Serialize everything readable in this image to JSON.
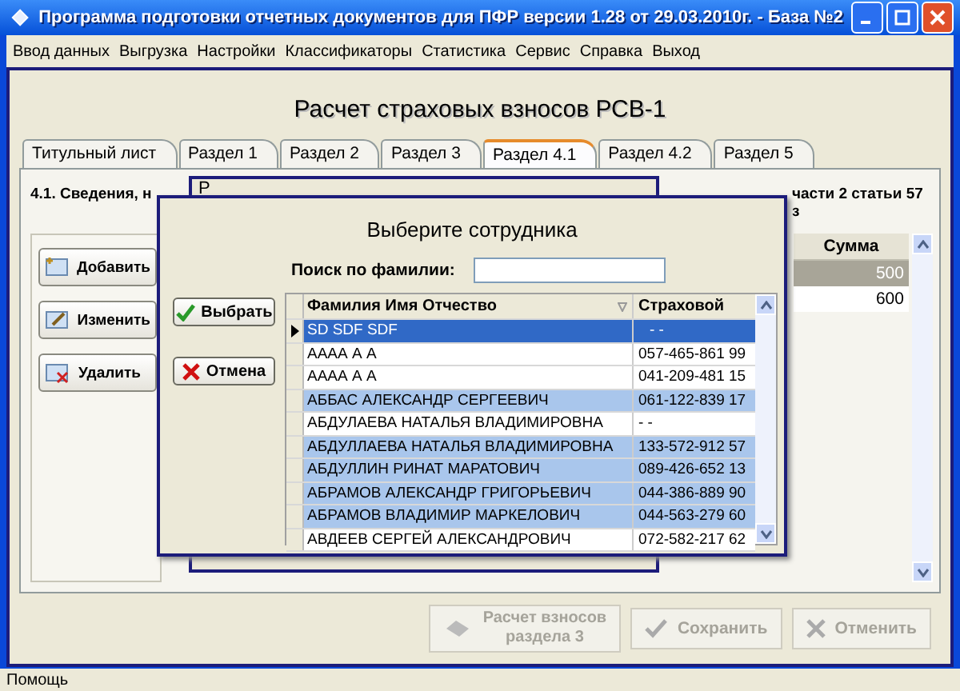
{
  "window": {
    "title": "Программа подготовки отчетных документов для ПФР версии 1.28 от 29.03.2010г. - База №2"
  },
  "menu": [
    "Ввод данных",
    "Выгрузка",
    "Настройки",
    "Классификаторы",
    "Статистика",
    "Сервис",
    "Справка",
    "Выход"
  ],
  "form_title": "Расчет страховых взносов РСВ-1",
  "tabs": [
    {
      "label": "Титульный лист",
      "selected": false
    },
    {
      "label": "Раздел 1",
      "selected": false
    },
    {
      "label": "Раздел 2",
      "selected": false
    },
    {
      "label": "Раздел 3",
      "selected": false
    },
    {
      "label": "Раздел 4.1",
      "selected": true
    },
    {
      "label": "Раздел 4.2",
      "selected": false
    },
    {
      "label": "Раздел 5",
      "selected": false
    }
  ],
  "section_heading_left": "4.1. Сведения, н",
  "section_heading_right": [
    "части 2 статьи 57",
    "з"
  ],
  "side_buttons": [
    {
      "label": "Добавить",
      "kind": "add"
    },
    {
      "label": "Изменить",
      "kind": "edit"
    },
    {
      "label": "Удалить",
      "kind": "delete"
    }
  ],
  "sum_table": {
    "column": "Сумма",
    "rows": [
      {
        "value": "500",
        "selected": true
      },
      {
        "value": "600",
        "selected": false
      }
    ]
  },
  "back_window": {
    "title": "Р"
  },
  "dialog": {
    "title": "Выберите сотрудника",
    "search_label": "Поиск по фамилии:",
    "buttons": [
      {
        "label": "Выбрать",
        "kind": "ok"
      },
      {
        "label": "Отмена",
        "kind": "cancel"
      }
    ],
    "columns": [
      "Фамилия Имя Отчество",
      "Страховой"
    ],
    "rows": [
      {
        "name": "SD SDF SDF",
        "number": "-  -",
        "selected": true,
        "marked": false
      },
      {
        "name": "АААА А А",
        "number": "057-465-861 99",
        "selected": false,
        "marked": false
      },
      {
        "name": "АААА А А",
        "number": "041-209-481 15",
        "selected": false,
        "marked": false
      },
      {
        "name": "АББАС АЛЕКСАНДР СЕРГЕЕВИЧ",
        "number": "061-122-839 17",
        "selected": false,
        "marked": true
      },
      {
        "name": "АБДУЛАЕВА НАТАЛЬЯ ВЛАДИМИРОВНА",
        "number": "-  -",
        "selected": false,
        "marked": false
      },
      {
        "name": "АБДУЛЛАЕВА НАТАЛЬЯ ВЛАДИМИРОВНА",
        "number": "133-572-912 57",
        "selected": false,
        "marked": true
      },
      {
        "name": "АБДУЛЛИН РИНАТ МАРАТОВИЧ",
        "number": "089-426-652 13",
        "selected": false,
        "marked": true
      },
      {
        "name": "АБРАМОВ АЛЕКСАНДР ГРИГОРЬЕВИЧ",
        "number": "044-386-889 90",
        "selected": false,
        "marked": true
      },
      {
        "name": "АБРАМОВ ВЛАДИМИР МАРКЕЛОВИЧ",
        "number": "044-563-279 60",
        "selected": false,
        "marked": true
      },
      {
        "name": "АВДЕЕВ СЕРГЕЙ АЛЕКСАНДРОВИЧ",
        "number": "072-582-217 62",
        "selected": false,
        "marked": false
      }
    ]
  },
  "bottom_buttons": [
    {
      "label": "Расчет взносов раздела 3",
      "kind": "calc",
      "disabled": true
    },
    {
      "label": "Сохранить",
      "kind": "save",
      "disabled": true
    },
    {
      "label": "Отменить",
      "kind": "cancel",
      "disabled": true
    }
  ],
  "status_bar": "Помощь"
}
